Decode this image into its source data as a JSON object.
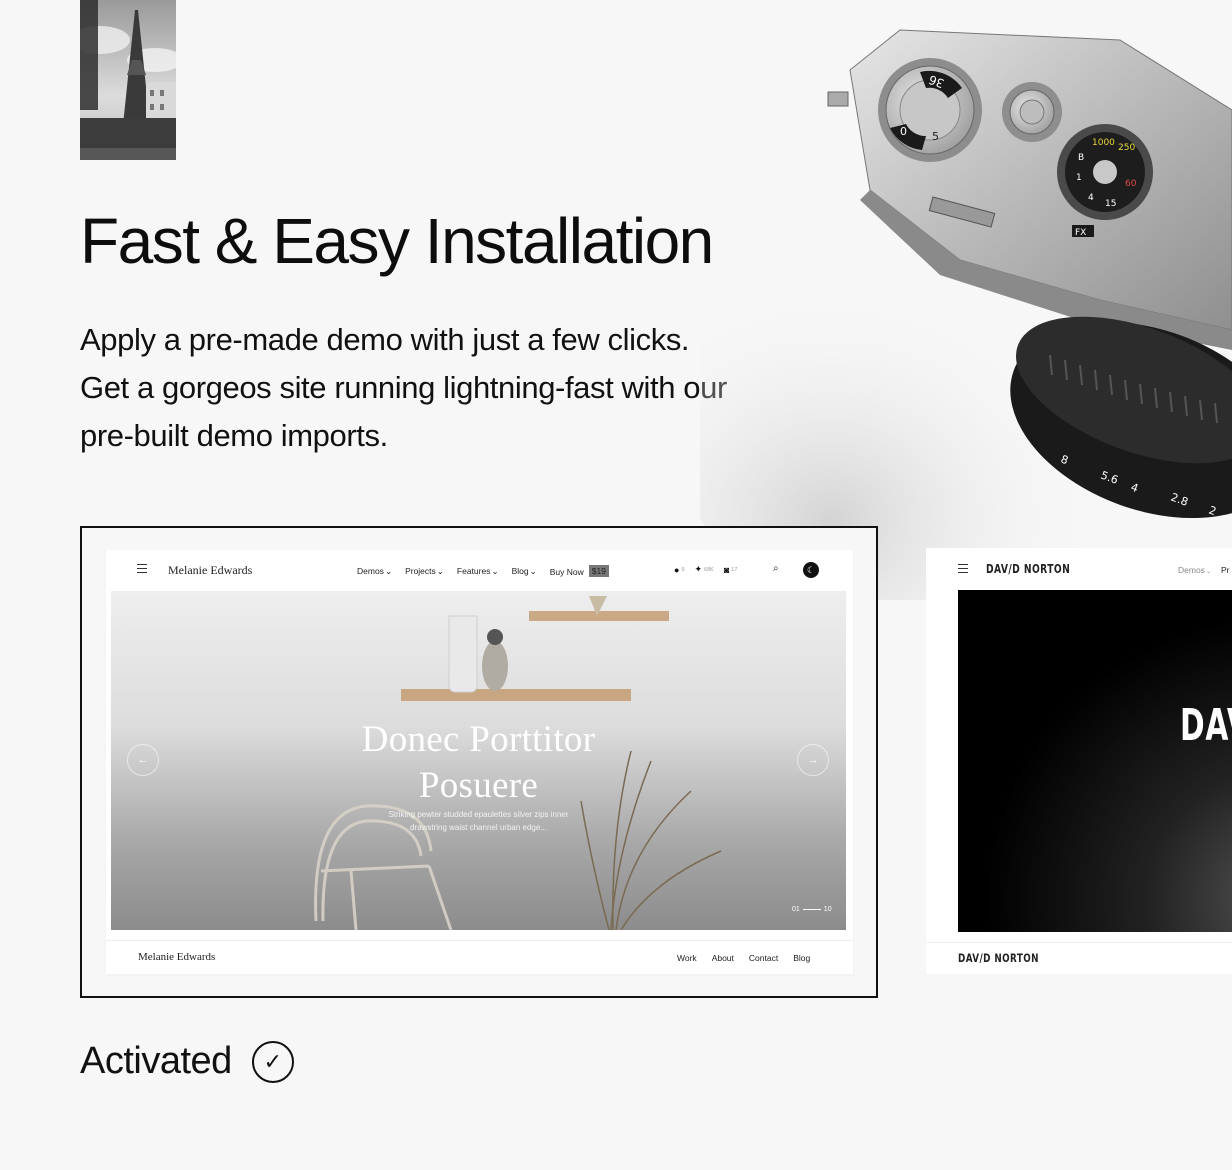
{
  "hero": {
    "title": "Fast & Easy Installation",
    "intro_lines": [
      "Apply a pre-made demo with just a few clicks.",
      "Get a gorgeos site running lightning-fast with our",
      "pre-built demo imports."
    ]
  },
  "demo_selected": {
    "brand": "Melanie Edwards",
    "menu": [
      {
        "label": "Demos",
        "muted": true
      },
      {
        "label": "Projects"
      },
      {
        "label": "Features"
      },
      {
        "label": "Blog"
      }
    ],
    "buy_now": "Buy Now",
    "price": "$19",
    "social": [
      {
        "icon": "facebook-icon",
        "count": "9"
      },
      {
        "icon": "twitter-icon",
        "count": "68K"
      },
      {
        "icon": "instagram-icon",
        "count": "17"
      }
    ],
    "slide_title_lines": [
      "Donec Porttitor",
      "Posuere"
    ],
    "slide_sub_lines": [
      "Striking pewter studded epaulettes silver zips inner",
      "drawstring waist channel urban edge..."
    ],
    "slide_current": "01",
    "slide_total": "10",
    "footer_brand": "Melanie Edwards",
    "footer_links": [
      "Work",
      "About",
      "Contact",
      "Blog"
    ]
  },
  "demo_next": {
    "brand": "DAV/D NORTON",
    "menu_first": "Demos",
    "menu_next_partial": "Pr",
    "hero_title_partial": "DAV",
    "footer_brand": "DAV/D NORTON"
  },
  "status": {
    "label": "Activated"
  },
  "colors": {
    "background": "#f7f7f7",
    "text": "#111111",
    "frame": "#111111"
  }
}
